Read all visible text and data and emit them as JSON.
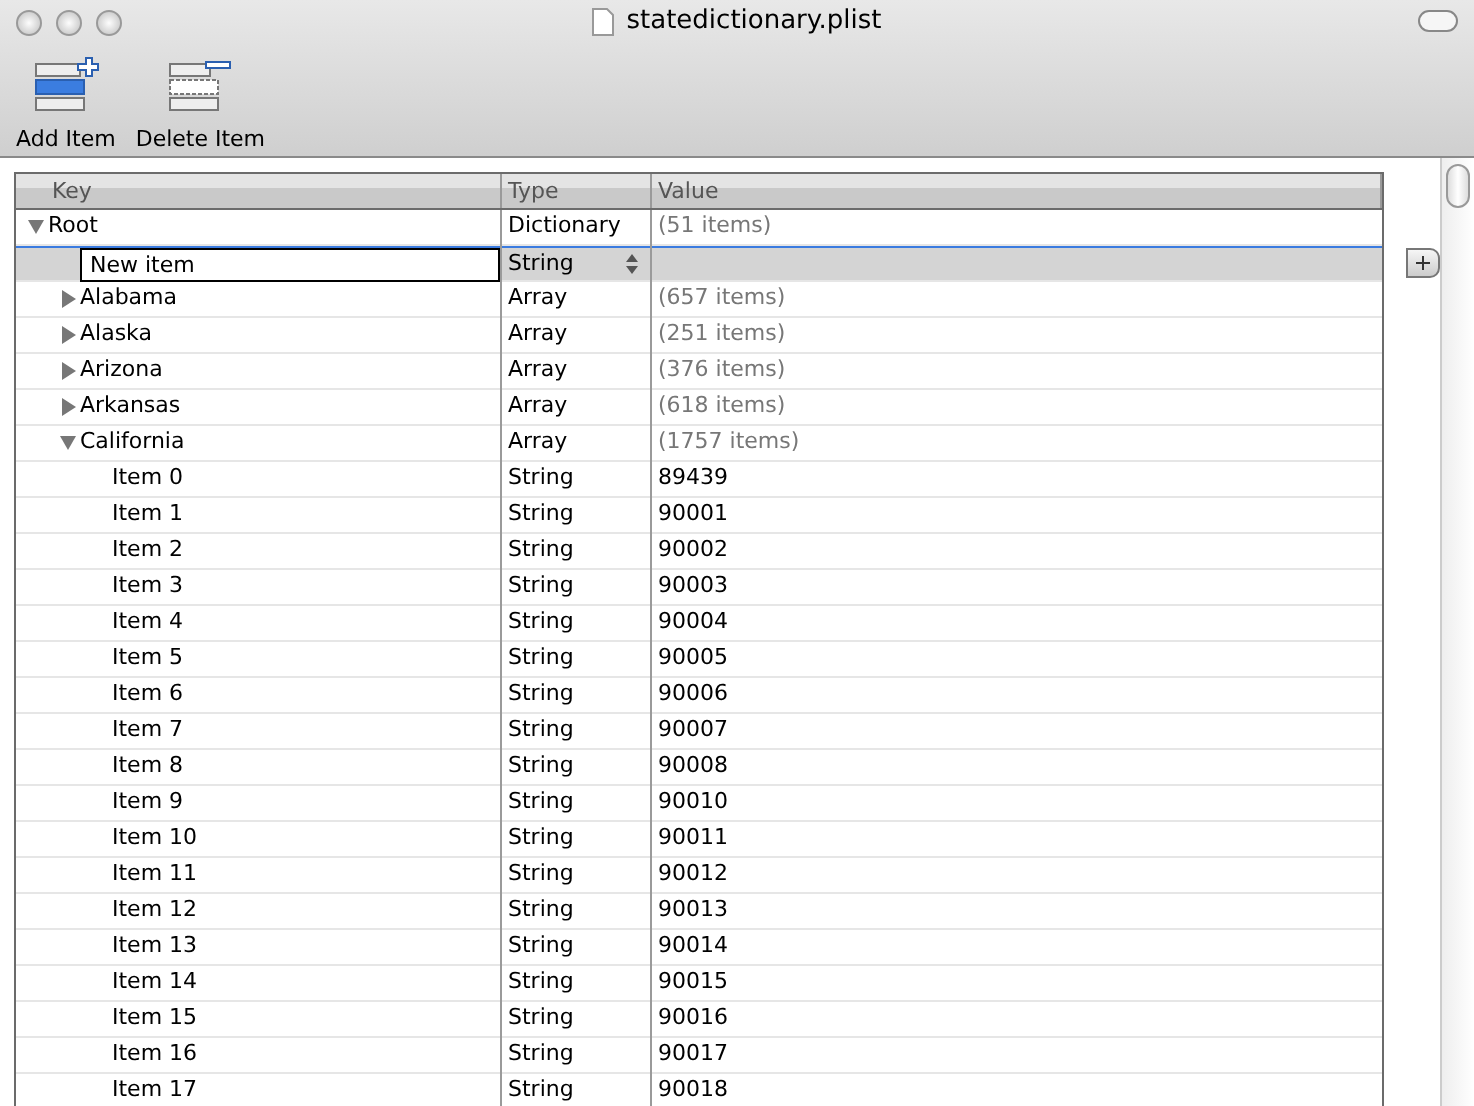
{
  "window": {
    "title": "statedictionary.plist"
  },
  "toolbar": [
    {
      "label": "Add Item",
      "kind": "add"
    },
    {
      "label": "Delete Item",
      "kind": "delete"
    }
  ],
  "table": {
    "columns": [
      "Key",
      "Type",
      "Value"
    ],
    "rows": [
      {
        "key": "Root",
        "type": "Dictionary",
        "value": "(51 items)",
        "expanded": true,
        "selected": false,
        "children": [
          {
            "key": "New item",
            "type": "String",
            "selected": true
          },
          {
            "key": "Alabama",
            "type": "Array",
            "value": "(657 items)",
            "expanded": false,
            "selected": false
          },
          {
            "key": "Alaska",
            "type": "Array",
            "value": "(251 items)",
            "expanded": false,
            "selected": false
          },
          {
            "key": "Arizona",
            "type": "Array",
            "value": "(376 items)",
            "expanded": false,
            "selected": false
          },
          {
            "key": "Arkansas",
            "type": "Array",
            "value": "(618 items)",
            "expanded": false,
            "selected": false
          },
          {
            "key": "California",
            "type": "Array",
            "value": "(1757 items)",
            "expanded": true,
            "selected": false,
            "children": [
              {
                "key": "Item 0",
                "type": "String",
                "value": "89439",
                "selected": false
              },
              {
                "key": "Item 1",
                "type": "String",
                "value": "90001",
                "selected": false
              },
              {
                "key": "Item 2",
                "type": "String",
                "value": "90002",
                "selected": false
              },
              {
                "key": "Item 3",
                "type": "String",
                "value": "90003",
                "selected": false
              },
              {
                "key": "Item 4",
                "type": "String",
                "value": "90004",
                "selected": false
              },
              {
                "key": "Item 5",
                "type": "String",
                "value": "90005",
                "selected": false
              },
              {
                "key": "Item 6",
                "type": "String",
                "value": "90006",
                "selected": false
              },
              {
                "key": "Item 7",
                "type": "String",
                "value": "90007",
                "selected": false
              },
              {
                "key": "Item 8",
                "type": "String",
                "value": "90008",
                "selected": false
              },
              {
                "key": "Item 9",
                "type": "String",
                "value": "90010",
                "selected": false
              },
              {
                "key": "Item 10",
                "type": "String",
                "value": "90011",
                "selected": false
              },
              {
                "key": "Item 11",
                "type": "String",
                "value": "90012",
                "selected": false
              },
              {
                "key": "Item 12",
                "type": "String",
                "value": "90013",
                "selected": false
              },
              {
                "key": "Item 13",
                "type": "String",
                "value": "90014",
                "selected": false
              },
              {
                "key": "Item 14",
                "type": "String",
                "value": "90015",
                "selected": false
              },
              {
                "key": "Item 15",
                "type": "String",
                "value": "90016",
                "selected": false
              },
              {
                "key": "Item 16",
                "type": "String",
                "value": "90017",
                "selected": false
              },
              {
                "key": "Item 17",
                "type": "String",
                "value": "90018",
                "selected": false
              }
            ]
          }
        ]
      }
    ]
  }
}
